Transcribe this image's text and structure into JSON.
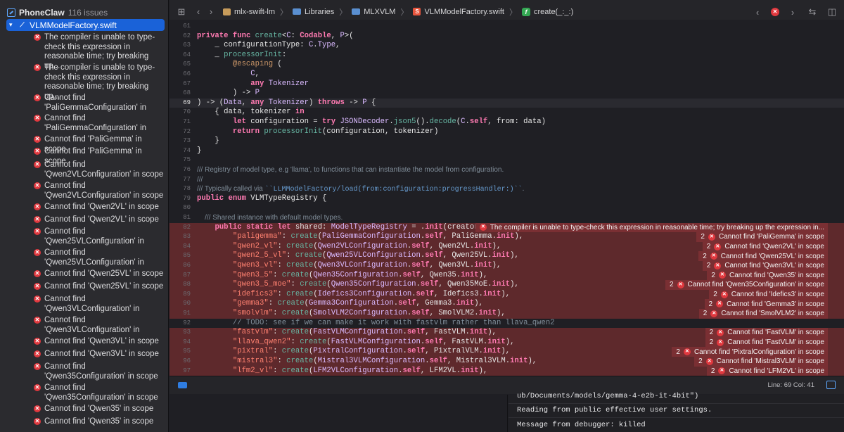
{
  "sidebar": {
    "project_name": "PhoneClaw",
    "issue_count": "116 issues",
    "file_name": "VLMModelFactory.swift",
    "issues": [
      "The compiler is unable to type-check this expression in reasonable time; try breaking up...",
      "The compiler is unable to type-check this expression in reasonable time; try breaking up...",
      "Cannot find 'PaliGemmaConfiguration' in",
      "Cannot find 'PaliGemmaConfiguration' in",
      "Cannot find 'PaliGemma' in scope",
      "Cannot find 'PaliGemma' in scope",
      "Cannot find 'Qwen2VLConfiguration' in scope",
      "Cannot find 'Qwen2VLConfiguration' in scope",
      "Cannot find 'Qwen2VL' in scope",
      "Cannot find 'Qwen2VL' in scope",
      "Cannot find 'Qwen25VLConfiguration' in",
      "Cannot find 'Qwen25VLConfiguration' in",
      "Cannot find 'Qwen25VL' in scope",
      "Cannot find 'Qwen25VL' in scope",
      "Cannot find 'Qwen3VLConfiguration' in",
      "Cannot find 'Qwen3VLConfiguration' in",
      "Cannot find 'Qwen3VL' in scope",
      "Cannot find 'Qwen3VL' in scope",
      "Cannot find 'Qwen35Configuration' in scope",
      "Cannot find 'Qwen35Configuration' in scope",
      "Cannot find 'Qwen35' in scope",
      "Cannot find 'Qwen35' in scope"
    ]
  },
  "jumpbar": {
    "crumbs": [
      "mlx-swift-lm",
      "Libraries",
      "MLXVLM",
      "VLMModelFactory.swift",
      "create(_:_:)"
    ]
  },
  "code": {
    "lines": [
      {
        "n": "61",
        "src": ""
      },
      {
        "n": "62",
        "src": "private func create<C: Codable, P>("
      },
      {
        "n": "63",
        "src": "    _ configurationType: C.Type,"
      },
      {
        "n": "64",
        "src": "    _ processorInit:"
      },
      {
        "n": "65",
        "src": "        @escaping ("
      },
      {
        "n": "66",
        "src": "            C,"
      },
      {
        "n": "67",
        "src": "            any Tokenizer"
      },
      {
        "n": "68",
        "src": "        ) -> P"
      },
      {
        "n": "69",
        "src": ") -> (Data, any Tokenizer) throws -> P {"
      },
      {
        "n": "70",
        "src": "    { data, tokenizer in"
      },
      {
        "n": "71",
        "src": "        let configuration = try JSONDecoder.json5().decode(C.self, from: data)"
      },
      {
        "n": "72",
        "src": "        return processorInit(configuration, tokenizer)"
      },
      {
        "n": "73",
        "src": "    }"
      },
      {
        "n": "74",
        "src": "}"
      },
      {
        "n": "75",
        "src": ""
      },
      {
        "n": "76",
        "src": "/// Registry of model type, e.g 'llama', to functions that can instantiate the model from configuration."
      },
      {
        "n": "77",
        "src": "///"
      },
      {
        "n": "78",
        "src": "/// Typically called via ``LLMModelFactory/load(from:configuration:progressHandler:)``."
      },
      {
        "n": "79",
        "src": "public enum VLMTypeRegistry {"
      },
      {
        "n": "80",
        "src": ""
      },
      {
        "n": "81",
        "src": "    /// Shared instance with default model types."
      },
      {
        "n": "82",
        "src": "    public static let shared: ModelTypeRegistry = .init(creators: ["
      },
      {
        "n": "83",
        "src": "        \"paligemma\": create(PaliGemmaConfiguration.self, PaliGemma.init),"
      },
      {
        "n": "84",
        "src": "        \"qwen2_vl\": create(Qwen2VLConfiguration.self, Qwen2VL.init),"
      },
      {
        "n": "85",
        "src": "        \"qwen2_5_vl\": create(Qwen25VLConfiguration.self, Qwen25VL.init),"
      },
      {
        "n": "86",
        "src": "        \"qwen3_vl\": create(Qwen3VLConfiguration.self, Qwen3VL.init),"
      },
      {
        "n": "87",
        "src": "        \"qwen3_5\": create(Qwen35Configuration.self, Qwen35.init),"
      },
      {
        "n": "88",
        "src": "        \"qwen3_5_moe\": create(Qwen35Configuration.self, Qwen35MoE.init),"
      },
      {
        "n": "89",
        "src": "        \"idefics3\": create(Idefics3Configuration.self, Idefics3.init),"
      },
      {
        "n": "90",
        "src": "        \"gemma3\": create(Gemma3Configuration.self, Gemma3.init),"
      },
      {
        "n": "91",
        "src": "        \"smolvlm\": create(SmolVLM2Configuration.self, SmolVLM2.init),"
      },
      {
        "n": "92",
        "src": "        // TODO: see if we can make it work with fastvlm rather than llava_qwen2"
      },
      {
        "n": "93",
        "src": "        \"fastvlm\": create(FastVLMConfiguration.self, FastVLM.init),"
      },
      {
        "n": "94",
        "src": "        \"llava_qwen2\": create(FastVLMConfiguration.self, FastVLM.init),"
      },
      {
        "n": "95",
        "src": "        \"pixtral\": create(PixtralConfiguration.self, PixtralVLM.init),"
      },
      {
        "n": "96",
        "src": "        \"mistral3\": create(Mistral3VLMConfiguration.self, Mistral3VLM.init),"
      },
      {
        "n": "97",
        "src": "        \"lfm2_vl\": create(LFM2VLConfiguration.self, LFM2VL.init),"
      }
    ],
    "annotations": {
      "82": {
        "count": "",
        "text": "The compiler is unable to type-check this expression in reasonable time; try breaking up the expression in..."
      },
      "83": {
        "count": "2",
        "text": "Cannot find 'PaliGemma' in scope"
      },
      "84": {
        "count": "2",
        "text": "Cannot find 'Qwen2VL' in scope"
      },
      "85": {
        "count": "2",
        "text": "Cannot find 'Qwen25VL' in scope"
      },
      "86": {
        "count": "2",
        "text": "Cannot find 'Qwen3VL' in scope"
      },
      "87": {
        "count": "2",
        "text": "Cannot find 'Qwen35' in scope"
      },
      "88": {
        "count": "2",
        "text": "Cannot find 'Qwen35Configuration' in scope"
      },
      "89": {
        "count": "2",
        "text": "Cannot find 'Idefics3' in scope"
      },
      "90": {
        "count": "2",
        "text": "Cannot find 'Gemma3' in scope"
      },
      "91": {
        "count": "2",
        "text": "Cannot find 'SmolVLM2' in scope"
      },
      "93": {
        "count": "2",
        "text": "Cannot find 'FastVLM' in scope"
      },
      "94": {
        "count": "2",
        "text": "Cannot find 'FastVLM' in scope"
      },
      "95": {
        "count": "2",
        "text": "Cannot find 'PixtralConfiguration' in scope"
      },
      "96": {
        "count": "2",
        "text": "Cannot find 'Mistral3VLM' in scope"
      },
      "97": {
        "count": "2",
        "text": "Cannot find 'LFM2VL' in scope"
      }
    },
    "current_line": "69"
  },
  "statusbar": {
    "position": "Line: 69  Col: 41"
  },
  "console": {
    "lines": [
      "ub/Documents/models/gemma-4-e2b-it-4bit\")",
      "Reading from public effective user settings.",
      "Message from debugger: killed"
    ]
  }
}
